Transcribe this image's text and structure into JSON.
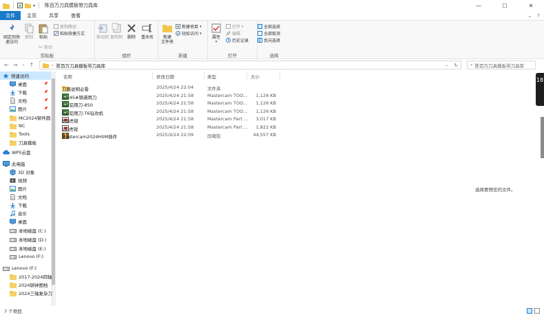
{
  "window": {
    "title": "陈百万刀具模板带刀具库",
    "minimize": "—",
    "maximize": "☐",
    "close": "✕"
  },
  "tabs": {
    "file": "文件",
    "home": "主页",
    "share": "共享",
    "view": "查看"
  },
  "ribbon": {
    "clipboard": {
      "label": "剪贴板",
      "pin_quick_access": "固定到快\n速访问",
      "copy": "复制",
      "paste": "粘贴",
      "copy_path": "复制路径",
      "paste_shortcut": "粘贴快捷方式",
      "cut": "剪切"
    },
    "organize": {
      "label": "组织",
      "move_to": "移动到",
      "copy_to": "复制到",
      "delete": "删除",
      "rename": "重命名"
    },
    "new": {
      "label": "新建",
      "new_folder": "新建\n文件夹",
      "new_item": "新建项目",
      "easy_access": "轻松访问"
    },
    "open": {
      "label": "打开",
      "properties": "属性",
      "open": "打开",
      "edit": "编辑",
      "history": "历史记录"
    },
    "select": {
      "label": "选择",
      "select_all": "全部选择",
      "select_none": "全部取消",
      "invert": "反向选择"
    }
  },
  "address": {
    "path": "陈百万刀具模板带刀具库",
    "search_placeholder": "陈百万刀具模板带刀具库"
  },
  "nav": {
    "items": [
      {
        "label": "快速访问",
        "icon": "star-icon",
        "pinned": false
      },
      {
        "label": "桌面",
        "icon": "desktop-icon",
        "pinned": true
      },
      {
        "label": "下载",
        "icon": "download-icon",
        "pinned": true
      },
      {
        "label": "文档",
        "icon": "document-icon",
        "pinned": true
      },
      {
        "label": "图片",
        "icon": "picture-icon",
        "pinned": true
      },
      {
        "label": "MC2024铆件圆",
        "icon": "folder-icon",
        "pinned": false
      },
      {
        "label": "NC",
        "icon": "folder-icon",
        "pinned": false
      },
      {
        "label": "Tools",
        "icon": "folder-icon",
        "pinned": false
      },
      {
        "label": "刀具模板",
        "icon": "folder-icon",
        "pinned": false
      },
      {
        "label": "WPS云盘",
        "icon": "cloud-icon",
        "pinned": false
      },
      {
        "label": "此电脑",
        "icon": "computer-icon",
        "pinned": false
      },
      {
        "label": "3D 对象",
        "icon": "cube-icon",
        "pinned": false
      },
      {
        "label": "视频",
        "icon": "video-icon",
        "pinned": false
      },
      {
        "label": "图片",
        "icon": "picture-icon",
        "pinned": false
      },
      {
        "label": "文档",
        "icon": "document-icon",
        "pinned": false
      },
      {
        "label": "下载",
        "icon": "download-icon",
        "pinned": false
      },
      {
        "label": "音乐",
        "icon": "music-icon",
        "pinned": false
      },
      {
        "label": "桌面",
        "icon": "desktop-icon",
        "pinned": false
      },
      {
        "label": "本地磁盘 (C:)",
        "icon": "drive-icon",
        "pinned": false
      },
      {
        "label": "本地磁盘 (D:)",
        "icon": "drive-icon",
        "pinned": false
      },
      {
        "label": "本地磁盘 (E:)",
        "icon": "drive-icon",
        "pinned": false
      },
      {
        "label": "Lenovo (F:)",
        "icon": "drive-icon",
        "pinned": false
      },
      {
        "label": "Lenovo (F:)",
        "icon": "drive-icon",
        "pinned": false
      },
      {
        "label": "2017-2024四轴",
        "icon": "folder-icon",
        "pinned": false
      },
      {
        "label": "2024铆钟图档",
        "icon": "folder-icon",
        "pinned": false
      },
      {
        "label": "2024三轴复杂刀",
        "icon": "folder-icon",
        "pinned": false
      }
    ]
  },
  "columns": {
    "name": "名称",
    "date": "修改日期",
    "type": "类型",
    "size": "大小"
  },
  "files": [
    {
      "name": "刀路说明必看",
      "date": "2025/4/24 22:04",
      "type": "文件夹",
      "size": "",
      "icon": "folder-icon"
    },
    {
      "name": "61-45#钢通用刀",
      "date": "2025/4/24 21:58",
      "type": "Mastercam TOO...",
      "size": "1,126 KB",
      "icon": "tool-file-icon"
    },
    {
      "name": "61-铝用刀-850",
      "date": "2025/4/24 21:58",
      "type": "Mastercam TOO...",
      "size": "1,126 KB",
      "icon": "tool-file-icon"
    },
    {
      "name": "61-铝用刀-T6钻攻机",
      "date": "2025/4/24 21:58",
      "type": "Mastercam TOO...",
      "size": "1,126 KB",
      "icon": "tool-file-icon"
    },
    {
      "name": "8钢虎钳",
      "date": "2025/4/24 21:58",
      "type": "Mastercam Part ...",
      "size": "3,017 KB",
      "icon": "part-file-icon"
    },
    {
      "name": "L铝虎钳",
      "date": "2025/4/24 21:58",
      "type": "Mastercam Part ...",
      "size": "1,822 KB",
      "icon": "part-file-icon"
    },
    {
      "name": "Mastercam2024HSM插件",
      "date": "2025/4/24 22:09",
      "type": "压缩包",
      "size": "44,557 KB",
      "icon": "archive-icon"
    }
  ],
  "preview_text": "选择要预览的文件。",
  "status": {
    "count": "7 个项目"
  },
  "edge_widget_text": "18",
  "colors": {
    "accent": "#1979ca",
    "selection": "#cce8ff",
    "folder": "#f2c54a"
  }
}
